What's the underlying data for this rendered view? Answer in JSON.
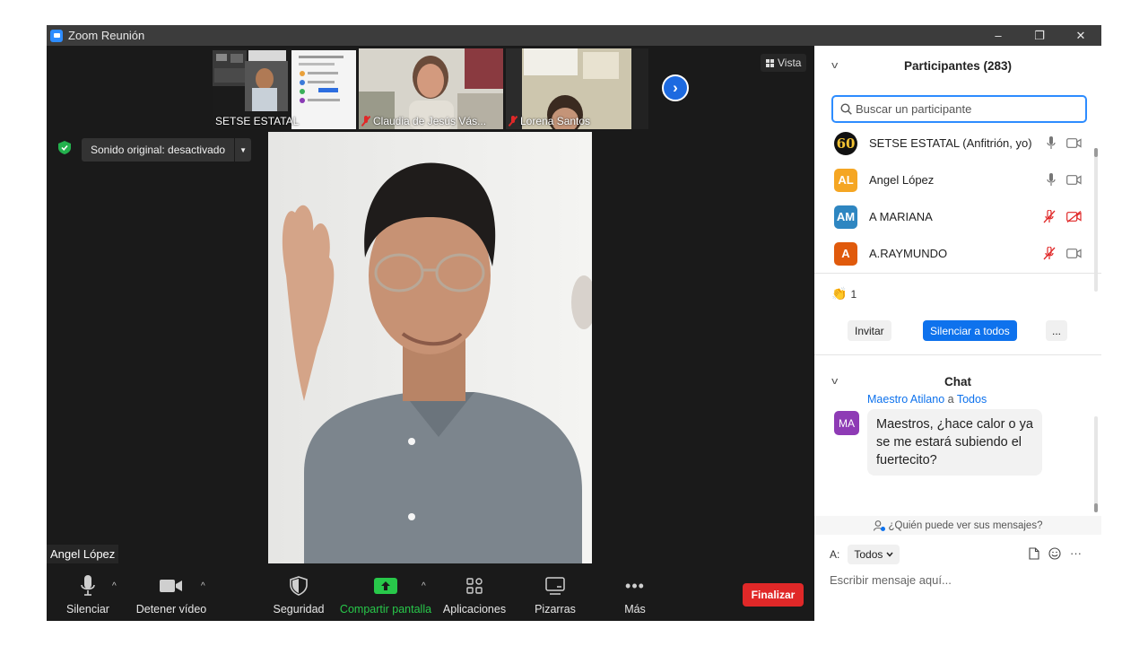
{
  "window": {
    "title": "Zoom Reunión",
    "minimize": "–",
    "restore": "❐",
    "close": "✕"
  },
  "thumbnails": [
    {
      "name": "SETSE ESTATAL",
      "muted": false
    },
    {
      "name": "Claudia de Jesús Vás...",
      "muted": true
    },
    {
      "name": "Lorena Santos",
      "muted": true
    }
  ],
  "view_button": "Vista",
  "original_sound": "Sonido original: desactivado",
  "speaker_name": "Angel López",
  "toolbar": {
    "mute": "Silenciar",
    "stop_video": "Detener vídeo",
    "security": "Seguridad",
    "share_screen": "Compartir pantalla",
    "apps": "Aplicaciones",
    "whiteboards": "Pizarras",
    "more": "Más",
    "end": "Finalizar"
  },
  "participants": {
    "title": "Participantes (283)",
    "search_placeholder": "Buscar un participante",
    "list": [
      {
        "initials": "60",
        "name": "SETSE ESTATAL (Anfitrión, yo)",
        "color": "#111111",
        "mic_muted": false,
        "video_off": false
      },
      {
        "initials": "AL",
        "name": "Angel López",
        "color": "#f5a623",
        "mic_muted": false,
        "video_off": false
      },
      {
        "initials": "AM",
        "name": "A MARIANA",
        "color": "#2e86c1",
        "mic_muted": true,
        "video_off": true
      },
      {
        "initials": "A",
        "name": "A.RAYMUNDO",
        "color": "#e05a0c",
        "mic_muted": true,
        "video_off": false
      }
    ],
    "raised_hands": "1",
    "invite": "Invitar",
    "mute_all": "Silenciar a todos",
    "more": "..."
  },
  "chat": {
    "title": "Chat",
    "message": {
      "sender": "Maestro Atilano",
      "connector": "a",
      "recipient": "Todos",
      "avatar": "MA",
      "avatar_color": "#8e3bb5",
      "text": "Maestros, ¿hace calor o ya se me estará subiendo el fuertecito?"
    },
    "who_can_see": "¿Quién puede ver sus mensajes?",
    "to_label": "A:",
    "to_value": "Todos",
    "input_placeholder": "Escribir mensaje aquí..."
  },
  "colors": {
    "accent": "#0e72ed",
    "end": "#e02828",
    "share": "#28c84a",
    "muted": "#e02828"
  }
}
